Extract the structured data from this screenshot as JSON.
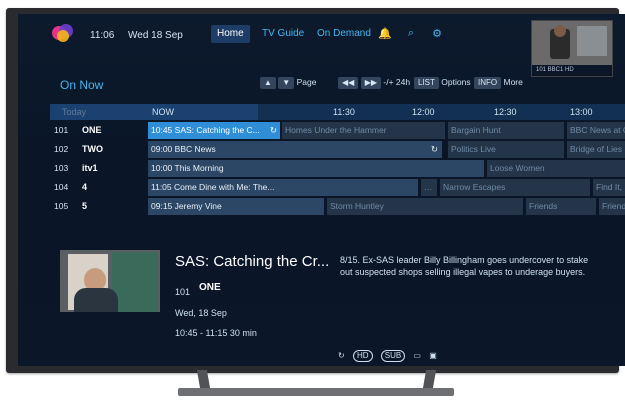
{
  "top": {
    "time": "11:06",
    "date": "Wed 18 Sep",
    "nav": [
      {
        "label": "Home"
      },
      {
        "label": "TV Guide"
      },
      {
        "label": "On Demand"
      }
    ],
    "icons": [
      "bell-icon",
      "search-icon",
      "gear-icon"
    ],
    "thumbnail_caption": "101 BBC1 HD"
  },
  "controls": {
    "on_now": "On Now",
    "page_label": "Page",
    "skip_label": "-/+ 24h",
    "list_chip": "LIST",
    "options_label": "Options",
    "info_chip": "INFO",
    "more_label": "More"
  },
  "timeline": {
    "today": "Today",
    "now": "NOW",
    "slots": [
      "11:30",
      "12:00",
      "12:30",
      "13:00"
    ]
  },
  "rows": [
    {
      "num": "101",
      "logo": "ONE",
      "programmes": [
        {
          "time": "10:45",
          "title": "SAS: Catching the C...",
          "style": "selected"
        },
        {
          "time": "",
          "title": "Homes Under the Hammer",
          "style": "future"
        },
        {
          "time": "",
          "title": "Bargain Hunt",
          "style": "future"
        },
        {
          "time": "",
          "title": "BBC News at O",
          "style": "future"
        }
      ]
    },
    {
      "num": "102",
      "logo": "TWO",
      "programmes": [
        {
          "time": "09:00",
          "title": "BBC News",
          "style": "now"
        },
        {
          "time": "",
          "title": "Politics Live",
          "style": "future"
        },
        {
          "time": "",
          "title": "Bridge of Lies",
          "style": "future"
        }
      ]
    },
    {
      "num": "103",
      "logo": "itv1",
      "programmes": [
        {
          "time": "10:00",
          "title": "This Morning",
          "style": "now"
        },
        {
          "time": "",
          "title": "Loose Women",
          "style": "future"
        }
      ]
    },
    {
      "num": "104",
      "logo": "4",
      "programmes": [
        {
          "time": "11:05",
          "title": "Come Dine with Me: The...",
          "style": "now"
        },
        {
          "time": "",
          "title": "Narrow Escapes",
          "style": "future"
        },
        {
          "time": "",
          "title": "Find It, F",
          "style": "future"
        }
      ]
    },
    {
      "num": "105",
      "logo": "5",
      "programmes": [
        {
          "time": "09:15",
          "title": "Jeremy Vine",
          "style": "now"
        },
        {
          "time": "",
          "title": "Storm Huntley",
          "style": "future"
        },
        {
          "time": "",
          "title": "Friends",
          "style": "future"
        },
        {
          "time": "",
          "title": "Friends",
          "style": "future"
        }
      ]
    }
  ],
  "detail": {
    "title": "SAS: Catching the Cr...",
    "channel_num": "101",
    "channel_logo": "ONE",
    "date": "Wed, 18 Sep",
    "time": "10:45 - 11:15 30 min",
    "description": "8/15. Ex-SAS leader Billy Billingham goes undercover to stake out suspected shops selling illegal vapes to underage buyers.",
    "badges": [
      "HD",
      "SUB"
    ]
  },
  "colors": {
    "accent": "#46b6f0",
    "selected": "#2e8ed8"
  }
}
